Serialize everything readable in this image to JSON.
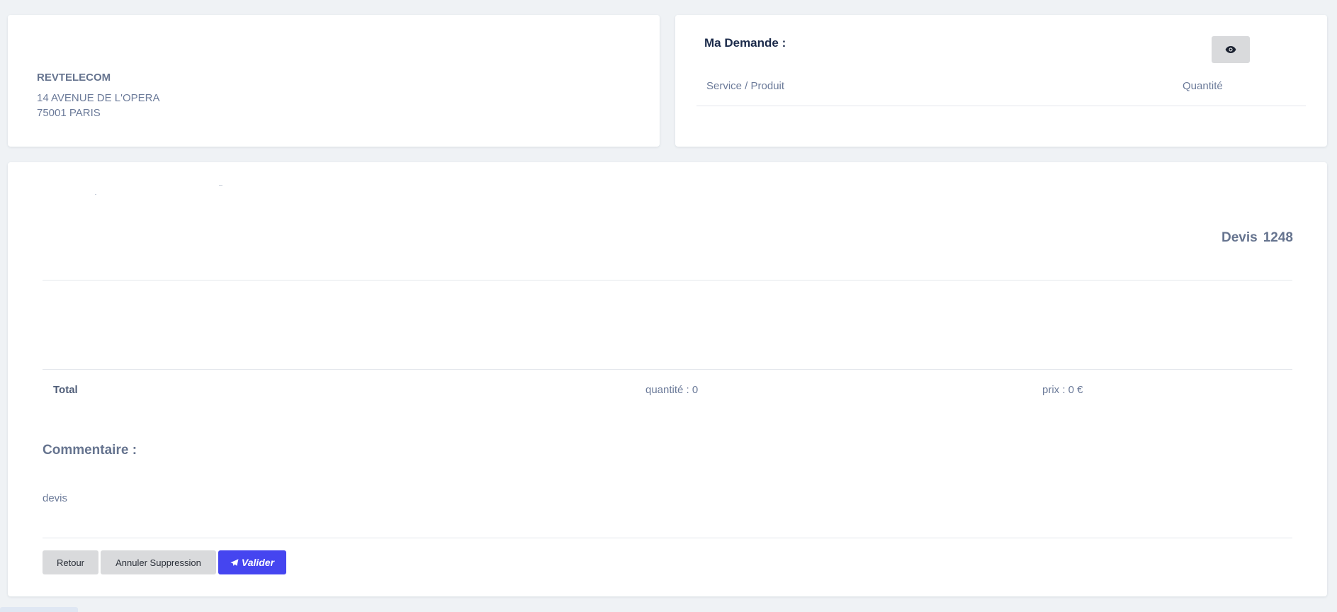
{
  "company": {
    "name": "REVTELECOM",
    "address_line1": "14 AVENUE DE L'OPERA",
    "address_line2": "75001 PARIS"
  },
  "demande": {
    "title": "Ma Demande :",
    "eye_icon": "eye-icon",
    "columns": [
      "Service / Produit",
      "Quantité"
    ]
  },
  "devis": {
    "label": "Devis",
    "number": "1248"
  },
  "totals": {
    "label": "Total",
    "quantite": "quantité : 0",
    "prix": "prix : 0 €"
  },
  "commentaire": {
    "title": "Commentaire :",
    "text": "devis"
  },
  "buttons": {
    "retour": "Retour",
    "annuler": "Annuler Suppression",
    "valider": "Valider",
    "valider_icon": "paper-plane-icon"
  },
  "colors": {
    "primary": "#4545f0",
    "secondary_button": "#d9dadc",
    "background": "#eff2f5"
  }
}
